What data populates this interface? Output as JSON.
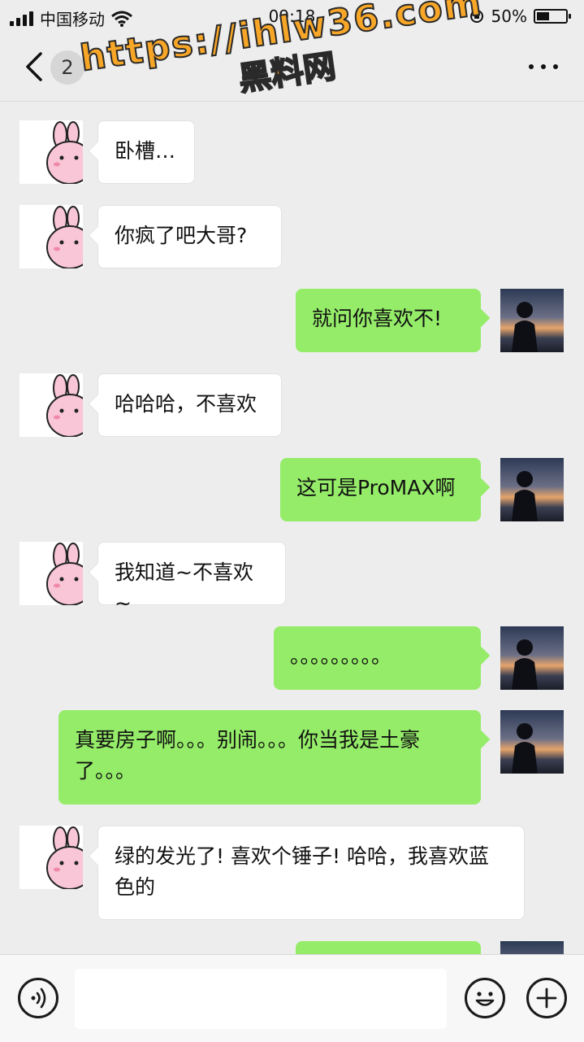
{
  "status_bar": {
    "carrier": "中国移动",
    "time": "09:18",
    "battery": "50%",
    "battery_level": 0.5
  },
  "nav": {
    "unread_count": "2",
    "title": ""
  },
  "watermark": {
    "line1": "https://ihlw36.com",
    "line2": "黑料网"
  },
  "messages": [
    {
      "side": "left",
      "text": "卧槽…"
    },
    {
      "side": "left",
      "text": "你疯了吧大哥?"
    },
    {
      "side": "right",
      "text": "就问你喜欢不!"
    },
    {
      "side": "left",
      "text": "哈哈哈，不喜欢"
    },
    {
      "side": "right",
      "text": "这可是ProMAX啊"
    },
    {
      "side": "left",
      "text": "我知道~不喜欢~"
    },
    {
      "side": "right",
      "text": "。。。。。。。。。"
    },
    {
      "side": "right",
      "text": "真要房子啊。。。别闹。。。你当我是土豪了。。。"
    },
    {
      "side": "left",
      "text": "绿的发光了! 喜欢个锤子! 哈哈，我喜欢蓝色的"
    },
    {
      "side": "right",
      "text": ""
    }
  ],
  "input_bar": {
    "text_value": ""
  },
  "icons": {
    "back": "chevron-left-icon",
    "more": "more-dots-icon",
    "voice": "voice-icon",
    "emoji": "emoji-icon",
    "add": "plus-icon"
  },
  "colors": {
    "background": "#ededed",
    "sent_bubble": "#95ec69",
    "received_bubble": "#ffffff",
    "watermark": "#f7a628"
  }
}
